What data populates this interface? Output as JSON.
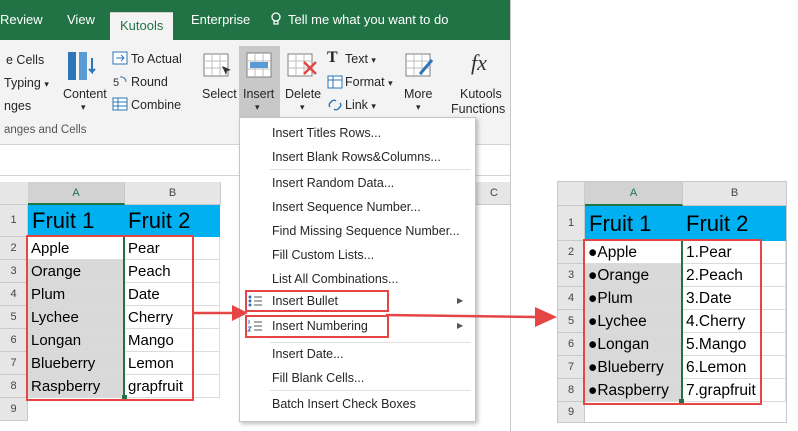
{
  "tabs": [
    "Review",
    "View",
    "Kutools",
    "Enterprise",
    "Tell me what you want to do"
  ],
  "ribbon": {
    "left_cut": [
      "e Cells",
      "Typing",
      "nges"
    ],
    "left_cut_arrow": "▾",
    "content_label": "Content",
    "to_actual": "To Actual",
    "round": "Round",
    "combine": "Combine",
    "select_label": "Select",
    "insert_label": "Insert",
    "delete_label": "Delete",
    "text_label": "Text",
    "format_label": "Format",
    "link_label": "Link",
    "more_label": "More",
    "kutools_functions": [
      "Kutools",
      "Functions"
    ],
    "group_label": "anges and Cells",
    "dropdown_arrow": "▾",
    "fx_glyph": "fx"
  },
  "menu": {
    "items": [
      "Insert Titles Rows...",
      "Insert Blank Rows&Columns...",
      "Insert Random Data...",
      "Insert Sequence Number...",
      "Find Missing Sequence Number...",
      "Fill Custom Lists...",
      "List All Combinations...",
      "Insert Bullet",
      "Insert Numbering",
      "Insert Date...",
      "Fill Blank Cells...",
      "Batch Insert Check Boxes"
    ],
    "submenu_arrow": "▶"
  },
  "left_sheet": {
    "columns": [
      "A",
      "B",
      "C"
    ],
    "rows": [
      "1",
      "2",
      "3",
      "4",
      "5",
      "6",
      "7",
      "8",
      "9"
    ],
    "header": [
      "Fruit 1",
      "Fruit 2"
    ],
    "col_a": [
      "Apple",
      "Orange",
      "Plum",
      "Lychee",
      "Longan",
      "Blueberry",
      "Raspberry"
    ],
    "col_b": [
      "Pear",
      "Peach",
      "Date",
      "Cherry",
      "Mango",
      "Lemon",
      "grapfruit"
    ]
  },
  "right_sheet": {
    "columns": [
      "A",
      "B"
    ],
    "rows": [
      "1",
      "2",
      "3",
      "4",
      "5",
      "6",
      "7",
      "8",
      "9"
    ],
    "header": [
      "Fruit 1",
      "Fruit 2"
    ],
    "col_a": [
      "●Apple",
      "●Orange",
      "●Plum",
      "●Lychee",
      "●Longan",
      "●Blueberry",
      "●Raspberry"
    ],
    "col_b": [
      "1.Pear",
      "2.Peach",
      "3.Date",
      "4.Cherry",
      "5.Mango",
      "6.Lemon",
      "7.grapfruit"
    ]
  },
  "colors": {
    "excel_green": "#217346",
    "header_blue": "#00b0f0",
    "highlight_red": "#e64545",
    "selected_gray": "#d9d9d9"
  }
}
